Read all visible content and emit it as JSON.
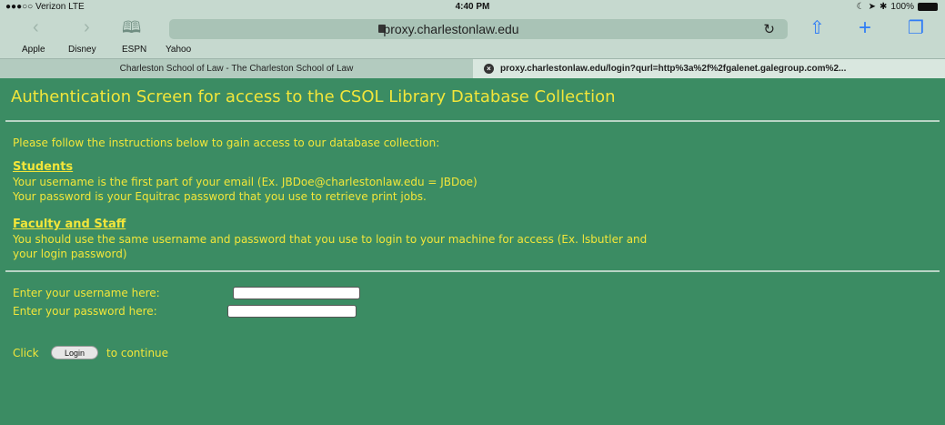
{
  "status": {
    "carrier": "●●●○○ Verizon  LTE",
    "time": "4:40 PM",
    "battery": "100%"
  },
  "toolbar": {
    "url": "proxy.charlestonlaw.edu"
  },
  "bookmarks": [
    "Apple",
    "Disney",
    "ESPN",
    "Yahoo"
  ],
  "tabs": [
    {
      "label": "Charleston School of Law - The Charleston School of Law"
    },
    {
      "label": "proxy.charlestonlaw.edu/login?qurl=http%3a%2f%2fgalenet.galegroup.com%2..."
    }
  ],
  "page": {
    "title": "Authentication Screen for access to the CSOL Library Database Collection",
    "intro": "Please follow the instructions below to gain access to our database collection:",
    "students_heading": "Students",
    "students_line1": "Your username is the first part of your email (Ex. JBDoe@charlestonlaw.edu = JBDoe)",
    "students_line2": "Your password is your Equitrac password that you use to retrieve print jobs.",
    "faculty_heading": "Faculty and Staff",
    "faculty_line1": "You should use the same username and password that you use to login to your machine for access (Ex. lsbutler and",
    "faculty_line2": "your login password)",
    "username_label": "Enter your username here:",
    "password_label": "Enter your password here:",
    "click_label": "Click",
    "login_button": "Login",
    "continue_label": "to continue"
  }
}
